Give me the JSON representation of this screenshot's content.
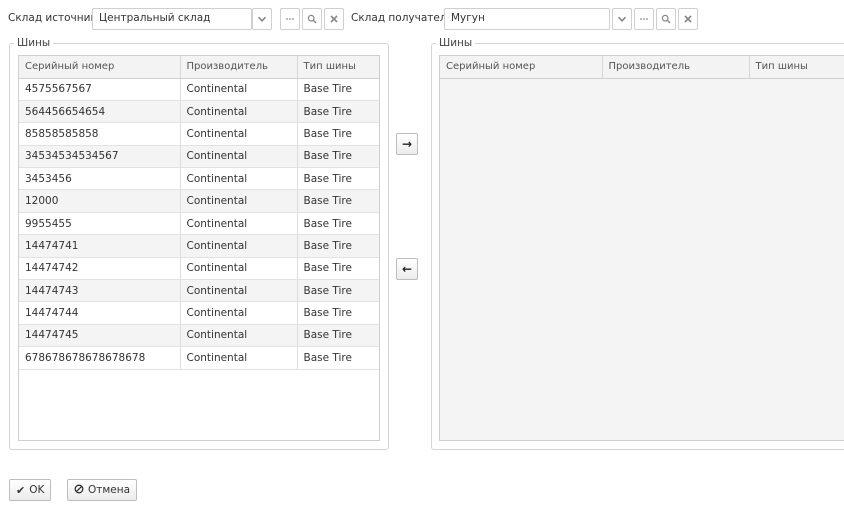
{
  "source": {
    "label": "Склад источник",
    "value": "Центральный склад"
  },
  "target": {
    "label": "Склад получатель",
    "value": "Мугун"
  },
  "left_panel": {
    "legend": "Шины",
    "columns": [
      "Серийный номер",
      "Производитель",
      "Тип шины"
    ],
    "rows": [
      [
        "4575567567",
        "Continental",
        "Base Tire"
      ],
      [
        "564456654654",
        "Continental",
        "Base Tire"
      ],
      [
        "85858585858",
        "Continental",
        "Base Tire"
      ],
      [
        "34534534534567",
        "Continental",
        "Base Tire"
      ],
      [
        "3453456",
        "Continental",
        "Base Tire"
      ],
      [
        "12000",
        "Continental",
        "Base Tire"
      ],
      [
        "9955455",
        "Continental",
        "Base Tire"
      ],
      [
        "14474741",
        "Continental",
        "Base Tire"
      ],
      [
        "14474742",
        "Continental",
        "Base Tire"
      ],
      [
        "14474743",
        "Continental",
        "Base Tire"
      ],
      [
        "14474744",
        "Continental",
        "Base Tire"
      ],
      [
        "14474745",
        "Continental",
        "Base Tire"
      ],
      [
        "678678678678678678",
        "Continental",
        "Base Tire"
      ]
    ]
  },
  "right_panel": {
    "legend": "Шины",
    "columns": [
      "Серийный номер",
      "Производитель",
      "Тип шины"
    ]
  },
  "buttons": {
    "ok": "OK",
    "cancel": "Отмена"
  },
  "icons": {
    "dropdown": "chevron-down-icon",
    "more": "ellipsis-icon",
    "search": "search-icon",
    "clear": "close-icon",
    "move_right": "arrow-right-icon",
    "move_left": "arrow-left-icon",
    "ok": "checkmark-icon",
    "cancel": "ban-icon"
  }
}
